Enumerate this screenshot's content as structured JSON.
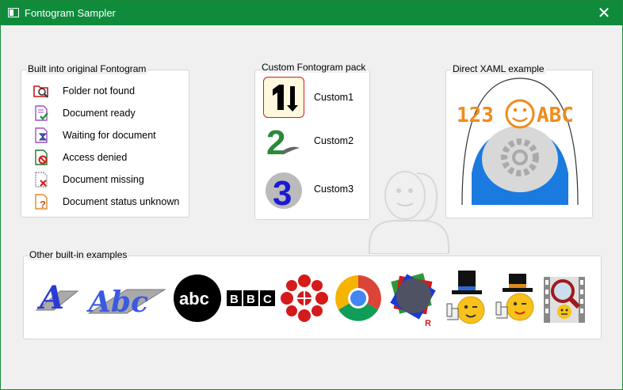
{
  "window": {
    "title": "Fontogram Sampler",
    "accent": "#108b3c"
  },
  "builtin_panel": {
    "header": "Built into original Fontogram",
    "items": [
      {
        "label": "Folder not found",
        "icon": "folder-search-icon"
      },
      {
        "label": "Document ready",
        "icon": "document-check-icon"
      },
      {
        "label": "Waiting for document",
        "icon": "document-hourglass-icon"
      },
      {
        "label": "Access denied",
        "icon": "document-denied-icon"
      },
      {
        "label": "Document missing",
        "icon": "document-missing-icon"
      },
      {
        "label": "Document status unknown",
        "icon": "document-question-icon"
      }
    ]
  },
  "custom_panel": {
    "header": "Custom Fontogram pack",
    "items": [
      {
        "label": "Custom1",
        "glyph": "1↓"
      },
      {
        "label": "Custom2",
        "glyph": "2"
      },
      {
        "label": "Custom3",
        "glyph": "3"
      }
    ]
  },
  "xaml_panel": {
    "header": "Direct XAML example",
    "text_left": "123",
    "text_right": "ABC"
  },
  "other_panel": {
    "header": "Other built-in examples",
    "abc_text": "abc",
    "bbc_letters": [
      "B",
      "B",
      "C"
    ],
    "film_a": "A",
    "film_abc": "Abc",
    "r_mark": "R"
  }
}
